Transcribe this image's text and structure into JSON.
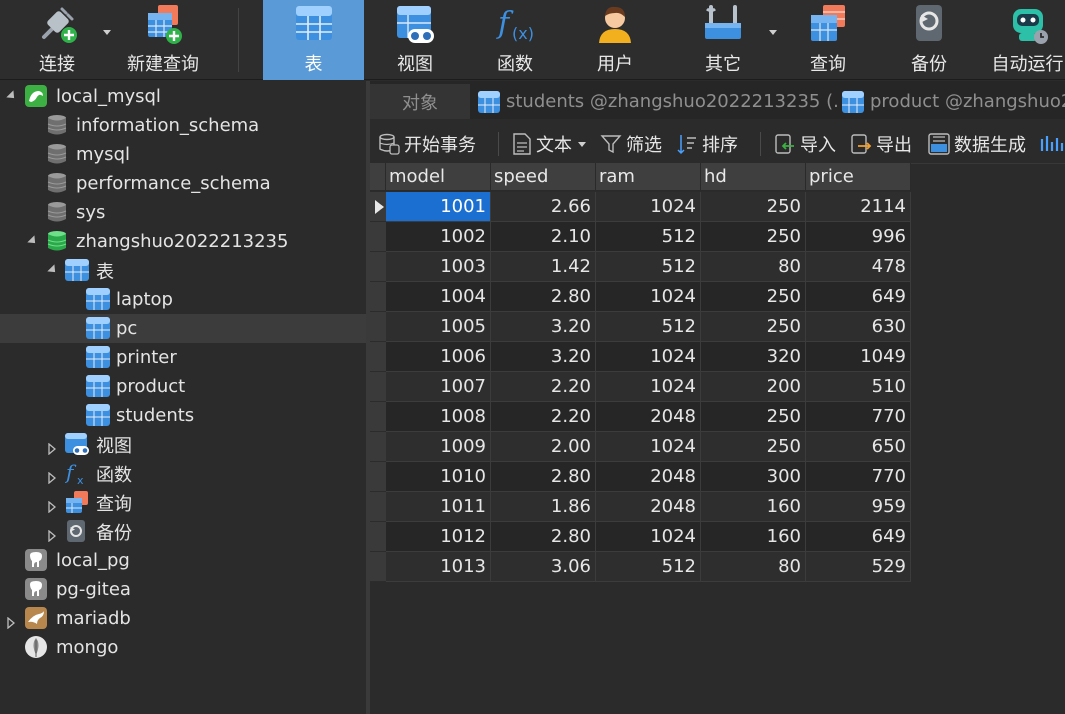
{
  "toolbar": {
    "connect_label": "连接",
    "new_query_label": "新建查询",
    "table_label": "表",
    "view_label": "视图",
    "function_label": "函数",
    "user_label": "用户",
    "other_label": "其它",
    "query_label": "查询",
    "backup_label": "备份",
    "autorun_label": "自动运行"
  },
  "sidebar": {
    "local_mysql": "local_mysql",
    "information_schema": "information_schema",
    "mysql": "mysql",
    "performance_schema": "performance_schema",
    "sys": "sys",
    "db": "zhangshuo2022213235",
    "tables_group": "表",
    "tables": [
      "laptop",
      "pc",
      "printer",
      "product",
      "students"
    ],
    "views_group": "视图",
    "functions_group": "函数",
    "queries_group": "查询",
    "backups_group": "备份",
    "local_pg": "local_pg",
    "pg_gitea": "pg-gitea",
    "mariadb": "mariadb",
    "mongo": "mongo"
  },
  "tabs": {
    "objects": "对象",
    "students": "students @zhangshuo2022213235 (...",
    "product": "product @zhangshuo2"
  },
  "subtoolbar": {
    "begin_tx": "开始事务",
    "text": "文本",
    "filter": "筛选",
    "sort": "排序",
    "import": "导入",
    "export": "导出",
    "data_gen": "数据生成"
  },
  "grid": {
    "columns": [
      "model",
      "speed",
      "ram",
      "hd",
      "price"
    ],
    "rows": [
      [
        "1001",
        "2.66",
        "1024",
        "250",
        "2114"
      ],
      [
        "1002",
        "2.10",
        "512",
        "250",
        "996"
      ],
      [
        "1003",
        "1.42",
        "512",
        "80",
        "478"
      ],
      [
        "1004",
        "2.80",
        "1024",
        "250",
        "649"
      ],
      [
        "1005",
        "3.20",
        "512",
        "250",
        "630"
      ],
      [
        "1006",
        "3.20",
        "1024",
        "320",
        "1049"
      ],
      [
        "1007",
        "2.20",
        "1024",
        "200",
        "510"
      ],
      [
        "1008",
        "2.20",
        "2048",
        "250",
        "770"
      ],
      [
        "1009",
        "2.00",
        "1024",
        "250",
        "650"
      ],
      [
        "1010",
        "2.80",
        "2048",
        "300",
        "770"
      ],
      [
        "1011",
        "1.86",
        "2048",
        "160",
        "959"
      ],
      [
        "1012",
        "2.80",
        "1024",
        "160",
        "649"
      ],
      [
        "1013",
        "3.06",
        "512",
        "80",
        "529"
      ]
    ]
  },
  "colors": {
    "accent": "#5a9ad6",
    "selection": "#1a6fd0",
    "mysql_green": "#3cb043",
    "table_blue": "#3d8fe0"
  }
}
